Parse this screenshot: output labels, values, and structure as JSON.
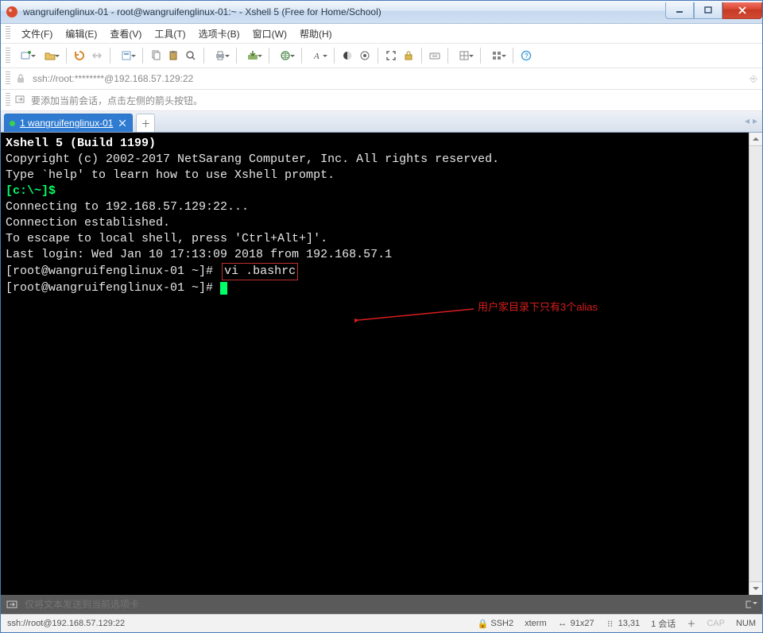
{
  "window": {
    "title": "wangruifenglinux-01 - root@wangruifenglinux-01:~ - Xshell 5 (Free for Home/School)"
  },
  "menubar": {
    "items": [
      "文件(F)",
      "编辑(E)",
      "查看(V)",
      "工具(T)",
      "选项卡(B)",
      "窗口(W)",
      "帮助(H)"
    ]
  },
  "addressbar": {
    "value": "ssh://root:********@192.168.57.129:22"
  },
  "tipbar": {
    "text": "要添加当前会话，点击左侧的箭头按钮。"
  },
  "tabs": {
    "items": [
      {
        "label": "1 wangruifenglinux-01"
      }
    ]
  },
  "terminal": {
    "header": "Xshell 5 (Build 1199)",
    "copyright": "Copyright (c) 2002-2017 NetSarang Computer, Inc. All rights reserved.",
    "blank1": "",
    "helpline": "Type `help' to learn how to use Xshell prompt.",
    "localprompt": "[c:\\~]$",
    "blank2": "",
    "connecting": "Connecting to 192.168.57.129:22...",
    "established": "Connection established.",
    "escape": "To escape to local shell, press 'Ctrl+Alt+]'.",
    "blank3": "",
    "lastlogin": "Last login: Wed Jan 10 17:13:09 2018 from 192.168.57.1",
    "prompt1": "[root@wangruifenglinux-01 ~]#",
    "cmd1": "vi .bashrc",
    "prompt2": "[root@wangruifenglinux-01 ~]#",
    "annotation": "用户家目录下只有3个alias"
  },
  "bottom_input": {
    "placeholder": "仅将文本发送到当前选项卡"
  },
  "statusbar": {
    "left": "ssh://root@192.168.57.129:22",
    "ssh": "SSH2",
    "term": "xterm",
    "size": "91x27",
    "pos": "13,31",
    "sessions": "1 会话",
    "cap": "CAP",
    "num": "NUM"
  }
}
